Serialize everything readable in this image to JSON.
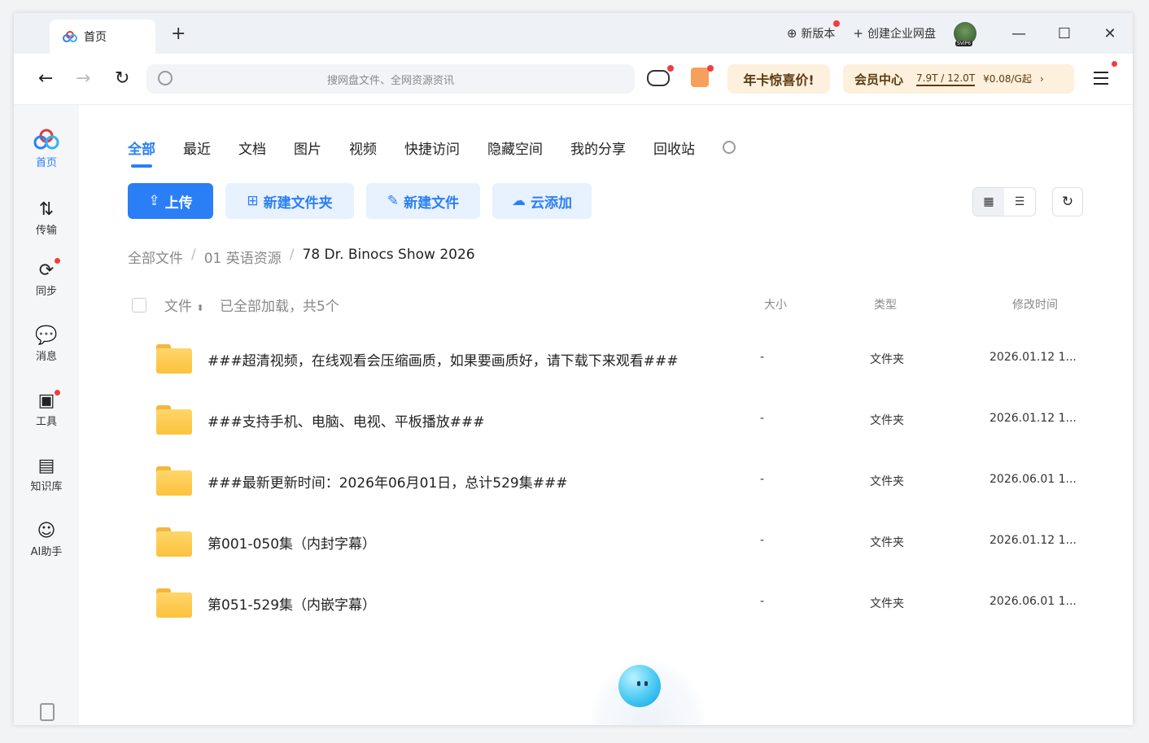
{
  "tab": {
    "label": "首页"
  },
  "titlebar": {
    "new_version": "新版本",
    "create_enterprise": "创建企业网盘",
    "avatar_badge": "SVIP6"
  },
  "search": {
    "placeholder": "搜网盘文件、全网资源资讯"
  },
  "promo": {
    "annual": "年卡惊喜价!",
    "member_center": "会员中心",
    "storage": "7.9T / 12.0T",
    "price": "¥0.08/G起"
  },
  "sidebar": {
    "items": [
      {
        "label": "首页",
        "icon": "baidu-netdisk-logo"
      },
      {
        "label": "传输",
        "icon": "transfer-icon"
      },
      {
        "label": "同步",
        "icon": "sync-icon"
      },
      {
        "label": "消息",
        "icon": "message-icon"
      },
      {
        "label": "工具",
        "icon": "toolbox-icon"
      },
      {
        "label": "知识库",
        "icon": "knowledge-base-icon"
      },
      {
        "label": "AI助手",
        "icon": "ai-assistant-icon"
      }
    ]
  },
  "categories": [
    "全部",
    "最近",
    "文档",
    "图片",
    "视频",
    "快捷访问",
    "隐藏空间",
    "我的分享",
    "回收站"
  ],
  "actions": {
    "upload": "上传",
    "new_folder": "新建文件夹",
    "new_file": "新建文件",
    "cloud_add": "云添加"
  },
  "breadcrumb": {
    "root": "全部文件",
    "level1": "01 英语资源",
    "current": "78 Dr. Binocs Show 2026"
  },
  "table": {
    "col_file": "文件",
    "loaded_note": "已全部加载，共5个",
    "col_size": "大小",
    "col_type": "类型",
    "col_modified": "修改时间"
  },
  "files": [
    {
      "name": "###超清视频，在线观看会压缩画质，如果要画质好，请下载下来观看###",
      "size": "-",
      "type": "文件夹",
      "modified": "2026.01.12 1..."
    },
    {
      "name": "###支持手机、电脑、电视、平板播放###",
      "size": "-",
      "type": "文件夹",
      "modified": "2026.01.12 1..."
    },
    {
      "name": "###最新更新时间：2026年06月01日，总计529集###",
      "size": "-",
      "type": "文件夹",
      "modified": "2026.06.01 1..."
    },
    {
      "name": "第001-050集（内封字幕）",
      "size": "-",
      "type": "文件夹",
      "modified": "2026.01.12 1..."
    },
    {
      "name": "第051-529集（内嵌字幕）",
      "size": "-",
      "type": "文件夹",
      "modified": "2026.06.01 1..."
    }
  ],
  "colors": {
    "accent": "#2a7ff6",
    "folder": "#fbc23d",
    "badge": "#f23c3c"
  }
}
